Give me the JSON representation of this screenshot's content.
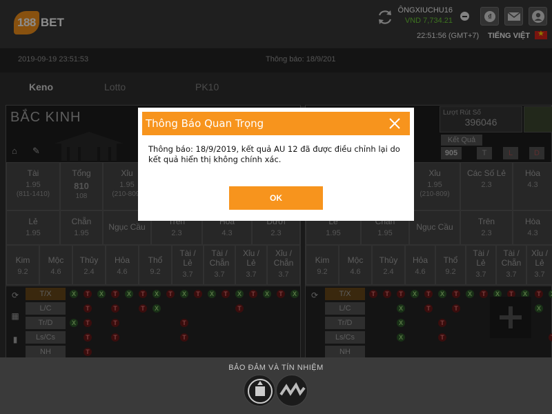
{
  "header": {
    "logo_badge": "188",
    "logo_text": "BET",
    "username": "ÔNGXIUCHU16",
    "balance": "VND 7,734.21",
    "time": "22:51:56 (GMT+7)",
    "language": "TIẾNG VIỆT"
  },
  "app": {
    "date": "2019-09-19 23:51:53",
    "notice": "Thông báo: 18/9/201",
    "tabs": [
      "Keno",
      "Lotto",
      "PK10"
    ],
    "left_panel": {
      "title": "BẮC KINH",
      "row1": [
        {
          "name": "Tài",
          "value": "1.95",
          "range": "(811-1410)"
        },
        {
          "name": "Tổng",
          "value": "810",
          "range": "108"
        },
        {
          "name": "Xỉu",
          "value": "1.95",
          "range": "(210-809)"
        }
      ],
      "row2": [
        {
          "name": "Lẻ",
          "value": "1.95"
        },
        {
          "name": "Chẵn",
          "value": "1.95"
        },
        {
          "name": "Ngục Cầu",
          "value": ""
        },
        {
          "name": "Trên",
          "value": "2.3"
        },
        {
          "name": "Hòa",
          "value": "4.3"
        },
        {
          "name": "Dưới",
          "value": "2.3"
        }
      ],
      "row3": [
        {
          "name": "Kim",
          "value": "9.2"
        },
        {
          "name": "Mộc",
          "value": "4.6"
        },
        {
          "name": "Thủy",
          "value": "2.4"
        },
        {
          "name": "Hỏa",
          "value": "4.6"
        },
        {
          "name": "Thổ",
          "value": "9.2"
        },
        {
          "name": "Tài / Lẻ",
          "value": "3.7"
        },
        {
          "name": "Tài / Chẵn",
          "value": "3.7"
        },
        {
          "name": "Xỉu / Lẻ",
          "value": "3.7"
        },
        {
          "name": "Xỉu / Chẵn",
          "value": "3.7"
        }
      ],
      "grid_labels": [
        "T/X",
        "L/C",
        "Tr/D",
        "Ls/Cs",
        "NH"
      ]
    },
    "right_panel": {
      "draw_label": "Lượt Rút Số",
      "draw_number": "396046",
      "result_label": "Kết Quả",
      "result_number": "905",
      "result_tags": [
        "T",
        "L",
        "D"
      ],
      "row1": [
        {
          "name": "Xỉu",
          "value": "1.95",
          "range": "(210-809)"
        },
        {
          "name": "Các Số Lẻ",
          "value": "2.3"
        },
        {
          "name": "Hòa",
          "value": "4.3"
        }
      ],
      "row2": [
        {
          "name": "Lẻ",
          "value": "1.95"
        },
        {
          "name": "Chẵn",
          "value": "1.95"
        },
        {
          "name": "Ngục Cầu",
          "value": ""
        },
        {
          "name": "Trên",
          "value": "2.3"
        },
        {
          "name": "Hòa",
          "value": "4.3"
        }
      ],
      "row3": [
        {
          "name": "Kim",
          "value": "9.2"
        },
        {
          "name": "Mộc",
          "value": "4.6"
        },
        {
          "name": "Thủy",
          "value": "2.4"
        },
        {
          "name": "Hỏa",
          "value": "4.6"
        },
        {
          "name": "Thổ",
          "value": "9.2"
        },
        {
          "name": "Tài / Lẻ",
          "value": "3.7"
        },
        {
          "name": "Tài / Chẵn",
          "value": "3.7"
        },
        {
          "name": "Xỉu / Lẻ",
          "value": "3.7"
        }
      ],
      "grid_labels": [
        "T/X",
        "L/C",
        "Tr/D",
        "Ls/Cs",
        "NH"
      ]
    }
  },
  "modal": {
    "title": "Thông Báo Quan Trọng",
    "body": "Thông báo: 18/9/2019, kết quả AU 12 đã được điều chỉnh lại do kết quả hiển thị không chính xác.",
    "ok_label": "OK"
  },
  "footer": {
    "title": "BẢO ĐẢM VÀ TÍN NHIỆM"
  },
  "colors": {
    "accent": "#f7941d",
    "balance": "#6fd13a",
    "header_bg": "#3a3a3a"
  }
}
